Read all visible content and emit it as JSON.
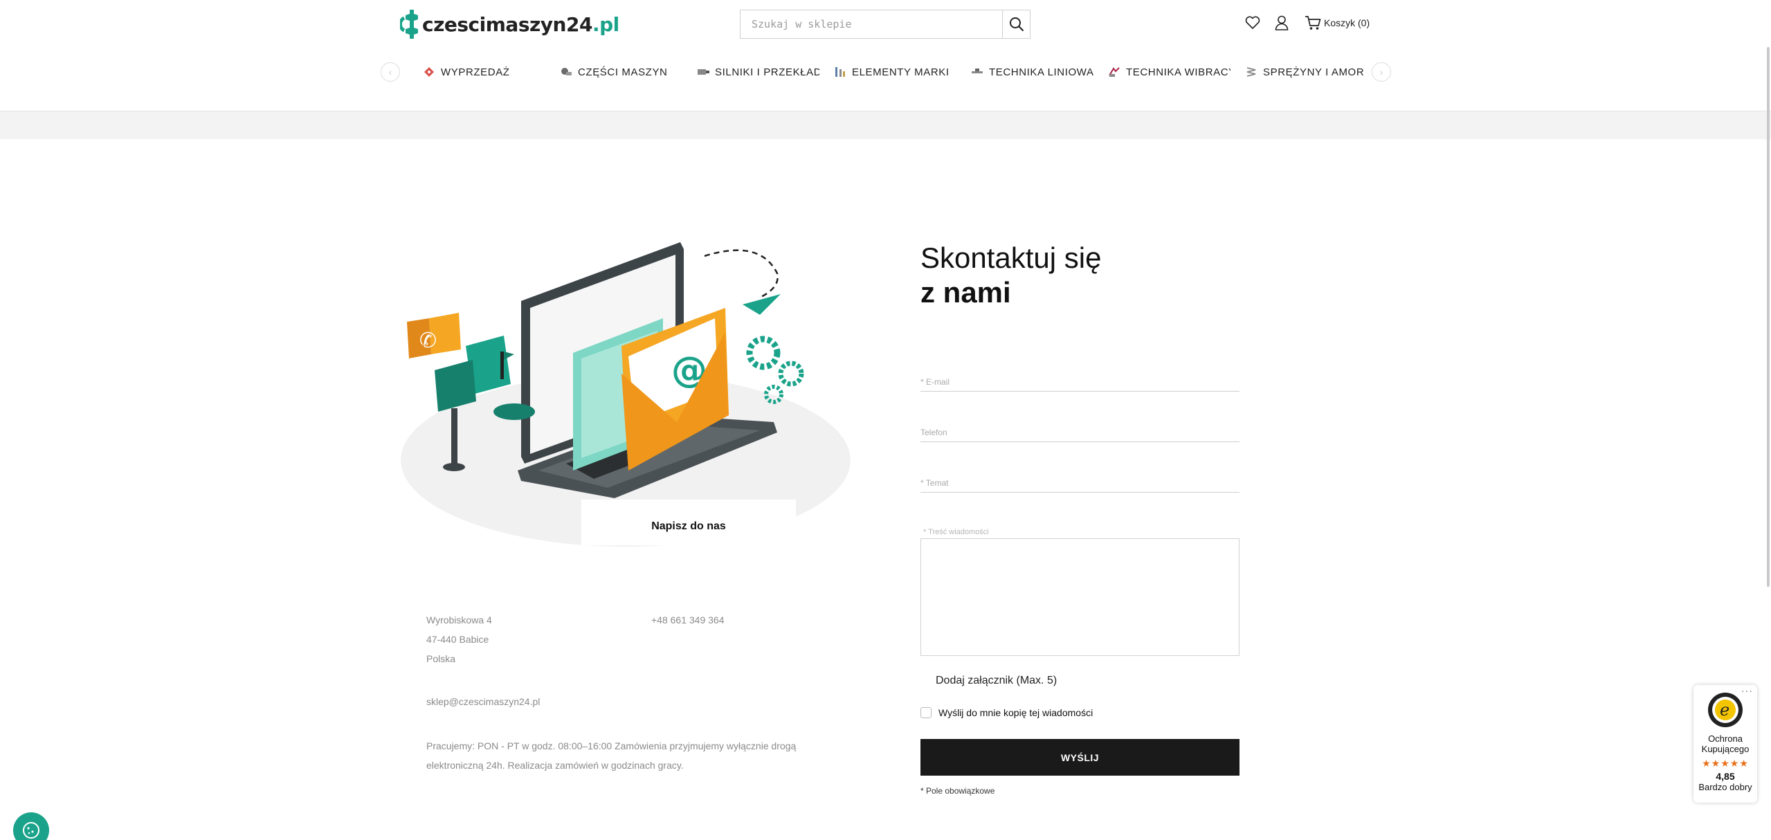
{
  "header": {
    "logo": {
      "main": "czescimaszyn24",
      "tld": ".pl"
    },
    "search": {
      "placeholder": "Szukaj w sklepie"
    },
    "cart_label": "Koszyk (0)"
  },
  "nav": {
    "items": [
      {
        "label": "WYPRZEDAŻ",
        "icon": "sale-icon"
      },
      {
        "label": "CZĘŚCI MASZYN",
        "icon": "machine-parts-icon"
      },
      {
        "label": "SILNIKI I PRZEKŁADNIE",
        "icon": "motor-icon"
      },
      {
        "label": "ELEMENTY MARKI",
        "icon": "brand-elements-icon"
      },
      {
        "label": "TECHNIKA LINIOWA",
        "icon": "linear-icon"
      },
      {
        "label": "TECHNIKA WIBRACYJNA",
        "icon": "vibration-icon"
      },
      {
        "label": "SPRĘŻYNY I AMORTYZATORY",
        "icon": "spring-icon"
      }
    ]
  },
  "illustration": {
    "caption": "Napisz do nas"
  },
  "contact": {
    "address": [
      "Wyrobiskowa 4",
      "47-440 Babice",
      "Polska"
    ],
    "phone": "+48 661 349 364",
    "email": "sklep@czescimaszyn24.pl",
    "hours": "Pracujemy: PON - PT w godz. 08:00–16:00 Zamówienia przyjmujemy wyłącznie drogą elektroniczną 24h. Realizacja zamówień w godzinach gracy."
  },
  "form": {
    "title_line1": "Skontaktuj się",
    "title_line2": "z nami",
    "email_placeholder": "* E-mail",
    "phone_placeholder": "Telefon",
    "subject_placeholder": "* Temat",
    "message_label": "* Treść wiadomości",
    "attach_label": "Dodaj załącznik (Max. 5)",
    "copy_label": "Wyślij do mnie kopię tej wiadomości",
    "submit_label": "WYŚLIJ",
    "required_note": "* Pole obowiązkowe"
  },
  "trust_badge": {
    "title_line1": "Ochrona",
    "title_line2": "Kupującego",
    "stars": "★★★★★",
    "score": "4,85",
    "verdict": "Bardzo dobry"
  },
  "colors": {
    "accent": "#1aa38a",
    "button": "#1a1a1a",
    "envelope": "#f5a623",
    "star": "#e8701a"
  }
}
